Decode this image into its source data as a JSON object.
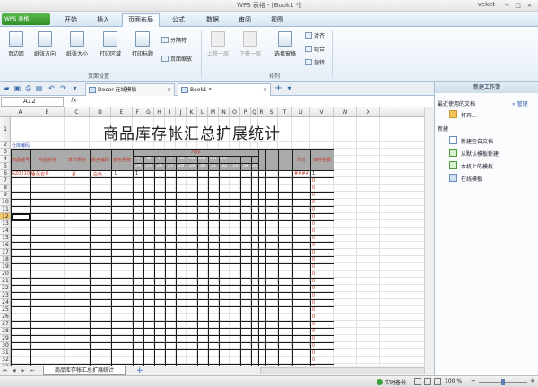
{
  "titlebar": {
    "title": "WPS 表格 - [Book1 *]",
    "user": "veket",
    "min": "−",
    "max": "□",
    "close": "×"
  },
  "menubar": {
    "wps_button": "WPS 表格",
    "items": [
      "开始",
      "插入",
      "页面布局",
      "公式",
      "数据",
      "审阅",
      "视图"
    ],
    "active_index": 2
  },
  "ribbon": {
    "page_setup": {
      "margin": "页边距",
      "orientation": "纸张方向",
      "size": "纸张大小",
      "print_area": "打印区域",
      "print_titles": "打印标题",
      "page_break": "分隔符",
      "page_zoom": "页面缩放",
      "group_label": "页面设置"
    },
    "arrange": {
      "bring_forward": "上移一层",
      "send_backward": "下移一层",
      "selection_pane": "选择窗格",
      "align": "对齐",
      "group": "组合",
      "rotate": "旋转",
      "group_label": "排列"
    }
  },
  "doc_tabs": [
    {
      "label": "Docer-在线模板",
      "close": "×"
    },
    {
      "label": "Book1 *",
      "close": "×"
    }
  ],
  "formula_bar": {
    "cell_ref": "A12",
    "fx": "fx",
    "content": ""
  },
  "columns": [
    "A",
    "B",
    "C",
    "D",
    "E",
    "F",
    "G",
    "H",
    "I",
    "J",
    "K",
    "L",
    "M",
    "N",
    "O",
    "P",
    "Q",
    "R",
    "S",
    "T",
    "U",
    "V",
    "W",
    "X"
  ],
  "rows": [
    "1",
    "2",
    "3",
    "4",
    "5",
    "6",
    "7",
    "8",
    "9",
    "10",
    "11",
    "12",
    "13",
    "14",
    "15",
    "16",
    "17",
    "18",
    "19",
    "20",
    "21",
    "22",
    "23",
    "24",
    "25",
    "26",
    "27",
    "28",
    "29",
    "30",
    "31",
    "32",
    "33"
  ],
  "sheet": {
    "title": "商品库存帐汇总扩展统计",
    "subtitle": "仓库编码",
    "header": {
      "product_code": "商品编号",
      "product_name": "商品名称",
      "season": "季节类别",
      "color_code": "颜色编码",
      "color_name": "颜色名称",
      "size_group": "尺码",
      "unit_price": "单价",
      "stock_amount": "库存金额"
    },
    "sizes_row1": [
      "S",
      "M",
      "L",
      "XL",
      "2XL",
      "3XL",
      "4XL",
      "5XL",
      "6XL"
    ],
    "sizes_row2": [
      "24",
      "25",
      "26",
      "27",
      "28",
      "29",
      "30",
      "31",
      "32",
      "33",
      "34",
      "35"
    ],
    "sizes_row3": [
      "35",
      "36",
      "37",
      "38",
      "39",
      "40",
      "41",
      "42",
      "43",
      "44",
      "45",
      "46",
      "47",
      "48",
      "其他"
    ],
    "row6": {
      "code": "GZ021001",
      "name": "女风衣号",
      "season": "夏",
      "color_code": "白色",
      "color_name": "L",
      "f": "1",
      "unit_price": "####",
      "stock": "1"
    },
    "zero_value": "0"
  },
  "sheet_tabs": {
    "active": "商品库存帐汇总扩展统计",
    "add": "+"
  },
  "taskpane": {
    "title": "新建工作簿",
    "recent_label": "最近使用的文档",
    "manage": "管理",
    "open": "打开...",
    "new_label": "新建",
    "links": [
      "新建空白文档",
      "从默认模板新建",
      "本机上的模板...",
      "在线模板"
    ]
  },
  "statusbar": {
    "backup": "实时备份",
    "zoom": "100 %"
  }
}
